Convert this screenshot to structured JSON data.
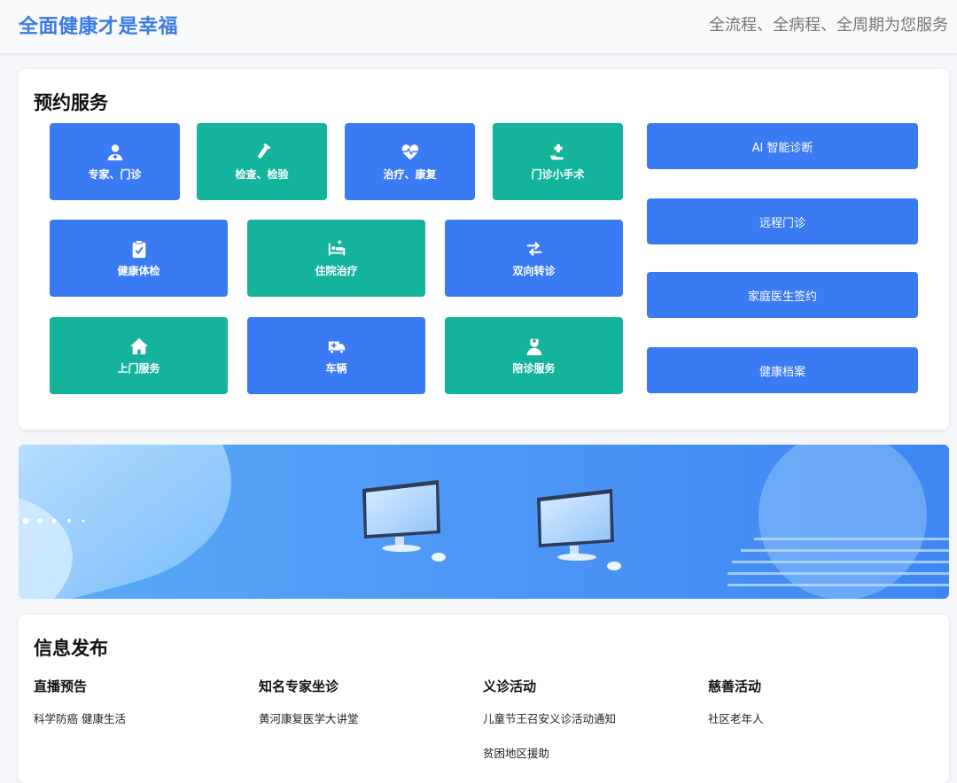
{
  "header": {
    "brand": "全面健康才是幸福",
    "tagline": "全流程、全病程、全周期为您服务"
  },
  "booking": {
    "title": "预约服务",
    "tiles": [
      {
        "label": "专家、门诊",
        "icon": "doctor-icon",
        "color": "#3a7bf4"
      },
      {
        "label": "检查、检验",
        "icon": "test-tube-icon",
        "color": "#14b39b"
      },
      {
        "label": "治疗、康复",
        "icon": "heartbeat-icon",
        "color": "#3a7bf4"
      },
      {
        "label": "门诊小手术",
        "icon": "hand-medical-icon",
        "color": "#14b39b"
      },
      {
        "label": "健康体检",
        "icon": "clipboard-check-icon",
        "color": "#3a7bf4"
      },
      {
        "label": "住院治疗",
        "icon": "hospital-bed-icon",
        "color": "#14b39b"
      },
      {
        "label": "双向转诊",
        "icon": "exchange-icon",
        "color": "#3a7bf4"
      },
      {
        "label": "上门服务",
        "icon": "home-icon",
        "color": "#14b39b"
      },
      {
        "label": "车辆",
        "icon": "ambulance-icon",
        "color": "#3a7bf4"
      },
      {
        "label": "陪诊服务",
        "icon": "nurse-icon",
        "color": "#14b39b"
      }
    ],
    "side_buttons": [
      "AI 智能诊断",
      "远程门诊",
      "家庭医生签约",
      "健康档案"
    ]
  },
  "info": {
    "title": "信息发布",
    "columns": [
      {
        "title": "直播预告",
        "items": [
          "科学防癌 健康生活"
        ]
      },
      {
        "title": "知名专家坐诊",
        "items": [
          "黄河康复医学大讲堂"
        ]
      },
      {
        "title": "义诊活动",
        "items": [
          "儿童节王召安义诊活动通知",
          "贫困地区援助"
        ]
      },
      {
        "title": "慈善活动",
        "items": [
          "社区老年人"
        ]
      }
    ]
  }
}
